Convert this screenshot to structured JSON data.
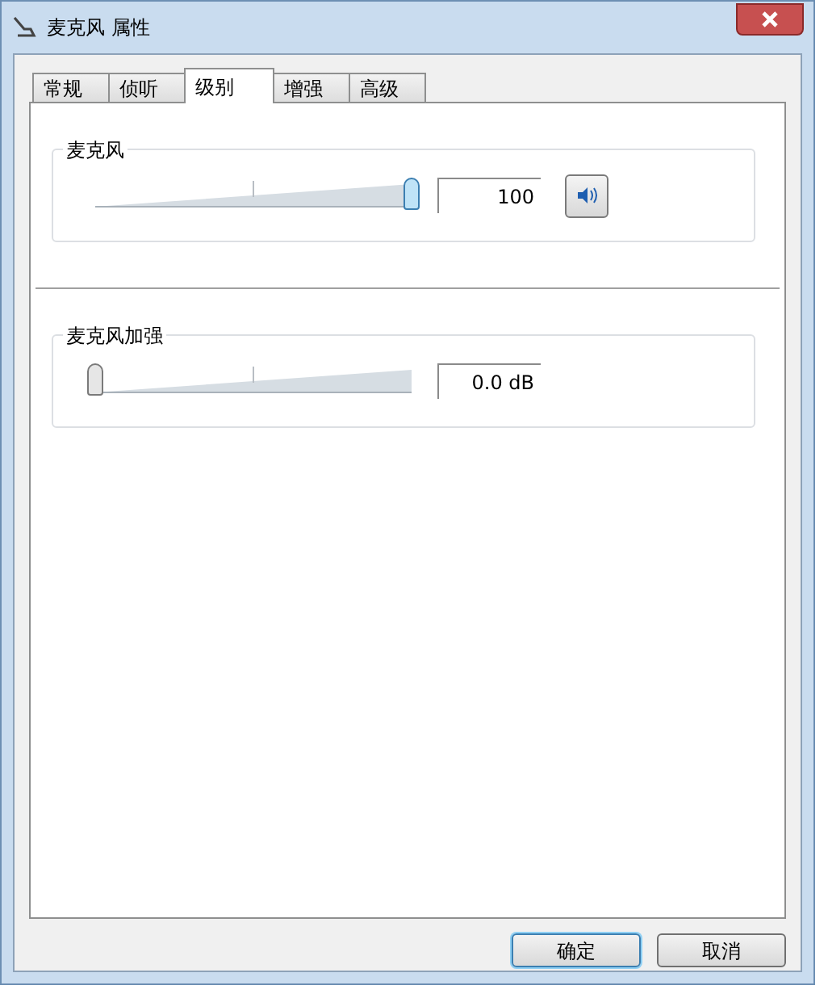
{
  "window": {
    "title": "麦克风 属性"
  },
  "tabs": [
    {
      "label": "常规",
      "selected": false
    },
    {
      "label": "侦听",
      "selected": false
    },
    {
      "label": "级别",
      "selected": true
    },
    {
      "label": "增强",
      "selected": false
    },
    {
      "label": "高级",
      "selected": false
    }
  ],
  "groups": [
    {
      "title": "麦克风",
      "level": 1,
      "reading": "100",
      "muted": false
    },
    {
      "title": "麦克风加强",
      "level": 0,
      "reading": "0.0 dB"
    }
  ],
  "buttons": [
    {
      "label": "确定",
      "default": true
    },
    {
      "label": "取消",
      "default": false
    }
  ]
}
